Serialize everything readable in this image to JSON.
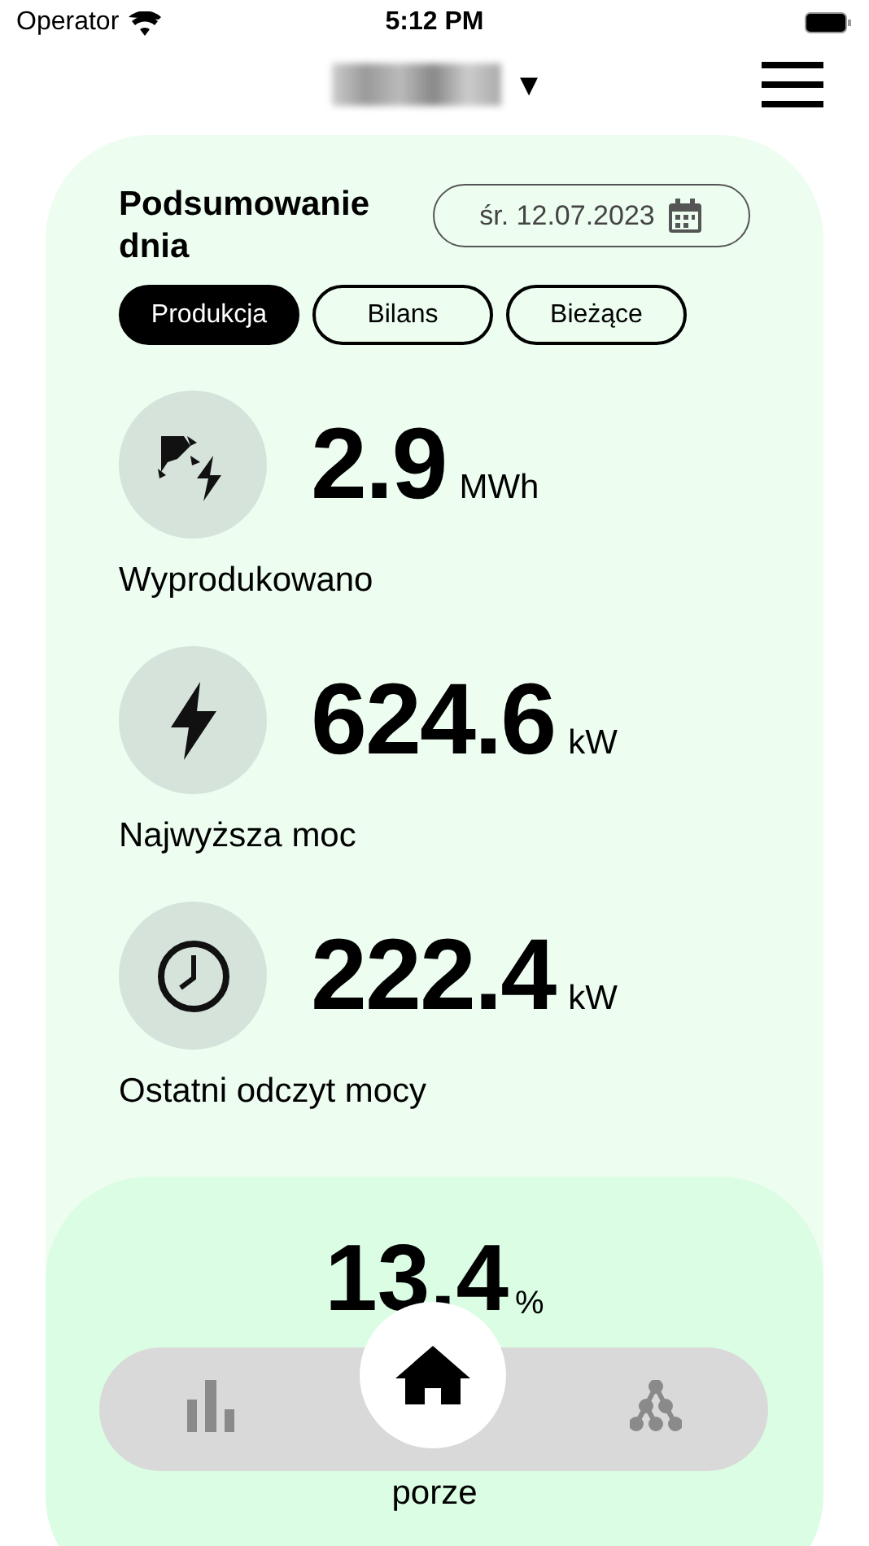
{
  "status_bar": {
    "carrier": "Operator",
    "time": "5:12 PM"
  },
  "header": {
    "site_dropdown": {
      "caret": "▾"
    }
  },
  "summary": {
    "title": "Podsumowanie dnia",
    "date": "śr. 12.07.2023",
    "tabs": [
      {
        "label": "Produkcja",
        "selected": true
      },
      {
        "label": "Bilans",
        "selected": false
      },
      {
        "label": "Bieżące",
        "selected": false
      }
    ],
    "stats": [
      {
        "kind": "production",
        "value": "2.9",
        "unit": "MWh",
        "label": "Wyprodukowano"
      },
      {
        "kind": "peak",
        "value": "624.6",
        "unit": "kW",
        "label": "Najwyższa moc"
      },
      {
        "kind": "clock",
        "value": "222.4",
        "unit": "kW",
        "label": "Ostatni odczyt mocy"
      }
    ]
  },
  "ratio": {
    "value": "13.4",
    "unit": "%",
    "label_end": "porze"
  },
  "bottom_nav": [
    {
      "kind": "chart",
      "selected": false
    },
    {
      "kind": "home",
      "selected": true
    },
    {
      "kind": "tree",
      "selected": false
    }
  ]
}
